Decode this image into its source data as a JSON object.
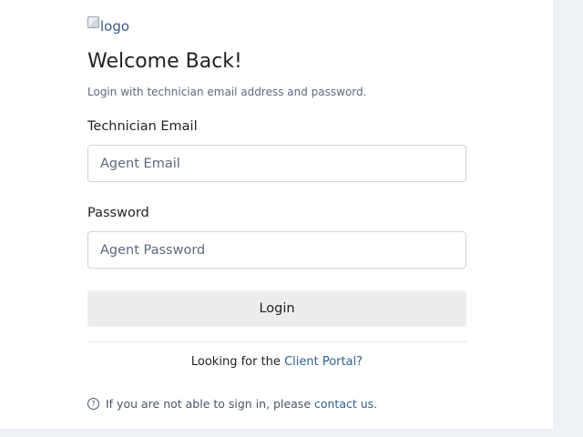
{
  "logo": {
    "alt_text": "logo"
  },
  "header": {
    "title": "Welcome Back!",
    "subtitle": "Login with technician email address and password."
  },
  "form": {
    "email_label": "Technician Email",
    "email_placeholder": "Agent Email",
    "email_value": "",
    "password_label": "Password",
    "password_placeholder": "Agent Password",
    "password_value": "",
    "login_label": "Login"
  },
  "footer": {
    "client_prefix": "Looking for the ",
    "client_link": "Client Portal?",
    "help_icon": "question-circle-icon",
    "help_prefix": "If you are not able to sign in, please ",
    "help_link": "contact us",
    "help_suffix": "."
  }
}
